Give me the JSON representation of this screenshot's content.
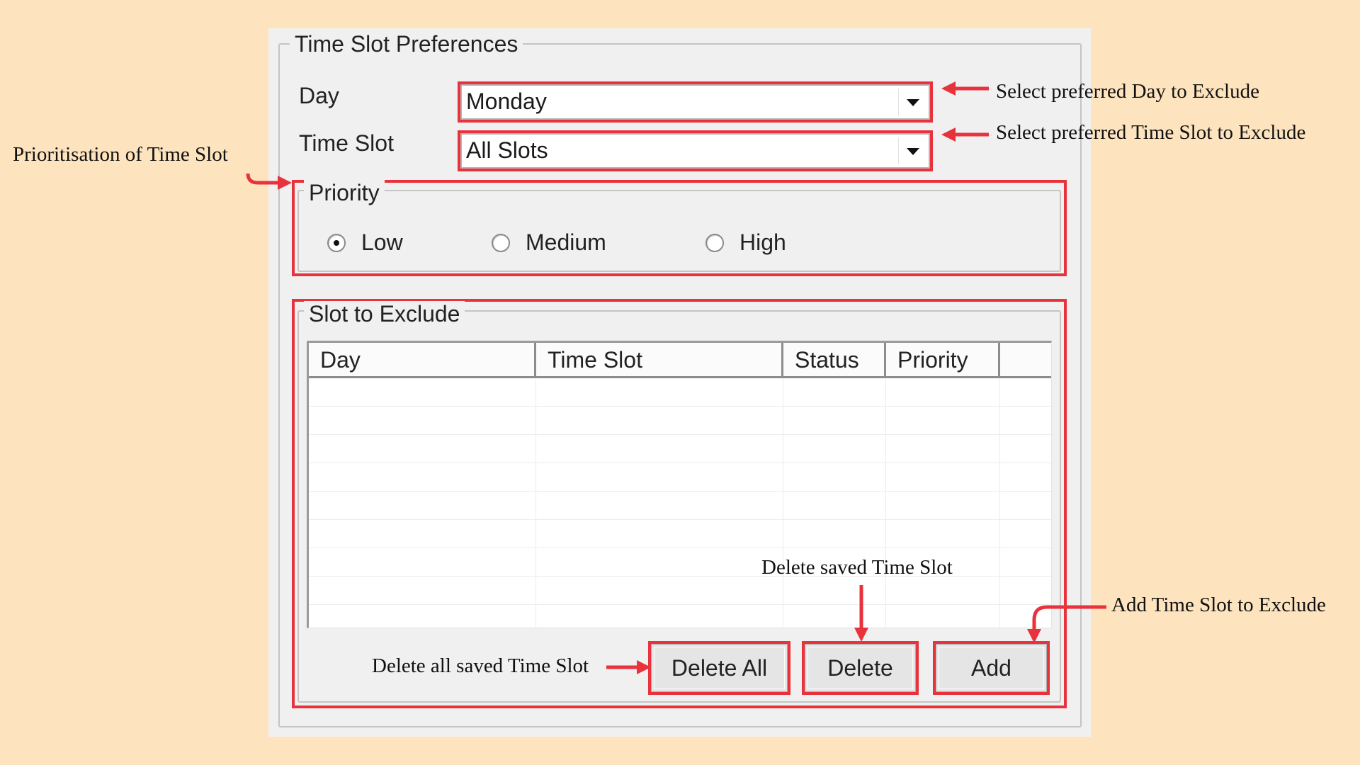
{
  "form": {
    "title": "Time Slot Preferences",
    "day_label": "Day",
    "day_value": "Monday",
    "timeslot_label": "Time Slot",
    "timeslot_value": "All Slots"
  },
  "priority": {
    "title": "Priority",
    "options": [
      {
        "label": "Low",
        "checked": true
      },
      {
        "label": "Medium",
        "checked": false
      },
      {
        "label": "High",
        "checked": false
      }
    ]
  },
  "exclude": {
    "title": "Slot to Exclude",
    "columns": [
      "Day",
      "Time Slot",
      "Status",
      "Priority",
      ""
    ],
    "rows": []
  },
  "buttons": {
    "delete_all": "Delete All",
    "delete": "Delete",
    "add": "Add"
  },
  "annotations": {
    "select_day": "Select preferred Day to Exclude",
    "select_timeslot": "Select preferred Time Slot to Exclude",
    "prioritisation": "Prioritisation of Time Slot",
    "delete_saved": "Delete saved Time Slot",
    "add_slot": "Add Time Slot to Exclude",
    "delete_all_saved": "Delete all saved Time Slot"
  },
  "colors": {
    "background": "#fde4be",
    "highlight": "#e8323c"
  }
}
